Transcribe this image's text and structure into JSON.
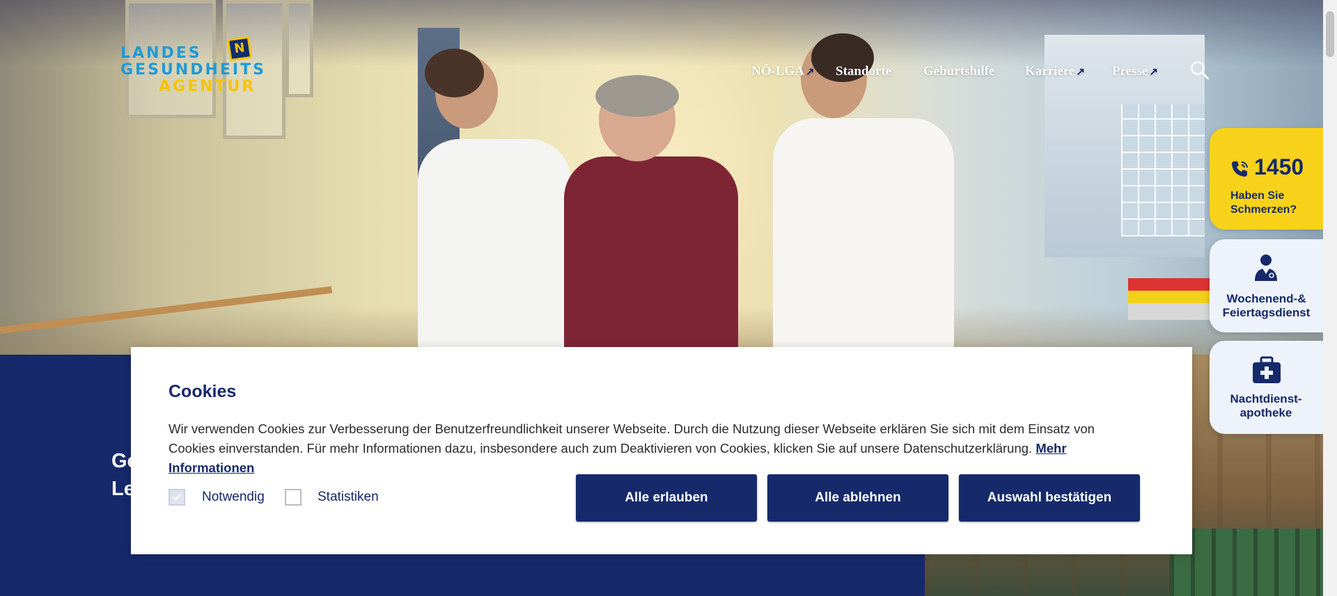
{
  "logo": {
    "line1": "LANDES",
    "line2": "GESUNDHEITS",
    "line3": "AGENTUR",
    "badge": "N"
  },
  "nav": {
    "items": [
      {
        "label": "NÖ-LGA",
        "external": true
      },
      {
        "label": "Standorte",
        "external": false
      },
      {
        "label": "Geburtshilfe",
        "external": false
      },
      {
        "label": "Karriere",
        "external": true
      },
      {
        "label": "Presse",
        "external": true
      }
    ],
    "external_icon": "↗",
    "search_icon": "search-icon"
  },
  "quick_access": {
    "hotline": {
      "number": "1450",
      "label": "Haben Sie Schmerzen?",
      "icon": "phone-icon"
    },
    "weekend_service": {
      "label": "Wochenend-& Feiertagsdienst",
      "icon": "doctor-icon"
    },
    "night_pharmacy": {
      "label": "Nachtdienst-apotheke",
      "icon": "medical-kit-icon"
    }
  },
  "hero": {
    "heading_line1": "Ge",
    "heading_line2": "Le"
  },
  "cookie": {
    "title": "Cookies",
    "text": "Wir verwenden Cookies zur Verbesserung der Benutzerfreundlichkeit unserer Webseite. Durch die Nutzung dieser Webseite erklären Sie sich mit dem Einsatz von Cookies einverstanden. Für mehr Informationen dazu, insbesondere auch zum Deaktivieren von Cookies, klicken Sie auf unsere Datenschutzerklärung.",
    "link": "Mehr Informationen",
    "options": [
      {
        "label": "Notwendig",
        "checked": true
      },
      {
        "label": "Statistiken",
        "checked": false
      }
    ],
    "buttons": {
      "allow_all": "Alle erlauben",
      "deny_all": "Alle ablehnen",
      "confirm": "Auswahl bestätigen"
    }
  },
  "colors": {
    "navy": "#16296b",
    "yellow": "#f8d21a",
    "logo_blue": "#1e9bd7",
    "logo_yellow": "#f5c400",
    "card_bg": "#eef3fb"
  }
}
